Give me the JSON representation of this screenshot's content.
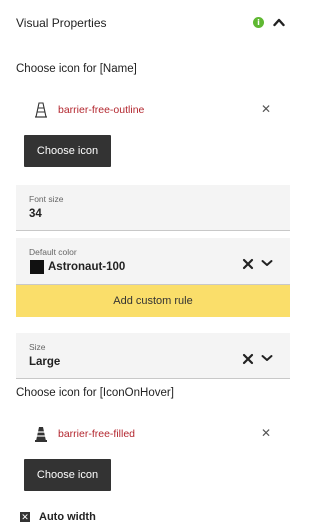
{
  "header": {
    "title": "Visual Properties",
    "info_icon": "info-icon",
    "info_color": "#5fb832",
    "collapse_icon": "chevron-up-icon"
  },
  "icon_name_section": {
    "label": "Choose icon for [Name]",
    "icon": "barrier-free-outline",
    "icon_text": "barrier-free-outline",
    "button_label": "Choose icon"
  },
  "font_size": {
    "label": "Font size",
    "value": "34"
  },
  "default_color": {
    "label": "Default color",
    "value": "Astronaut-100",
    "swatch_color": "#111111"
  },
  "custom_rule": {
    "label": "Add custom rule",
    "color": "#fade6a"
  },
  "size": {
    "label": "Size",
    "value": "Large"
  },
  "icon_hover_section": {
    "label": "Choose icon for [IconOnHover]",
    "icon": "barrier-free-filled",
    "icon_text": "barrier-free-filled",
    "button_label": "Choose icon"
  },
  "auto_width": {
    "label": "Auto width",
    "checked": true
  },
  "colors": {
    "accent_text": "#b3262e",
    "button_dark": "#333333",
    "field_bg": "#f4f4f4"
  }
}
